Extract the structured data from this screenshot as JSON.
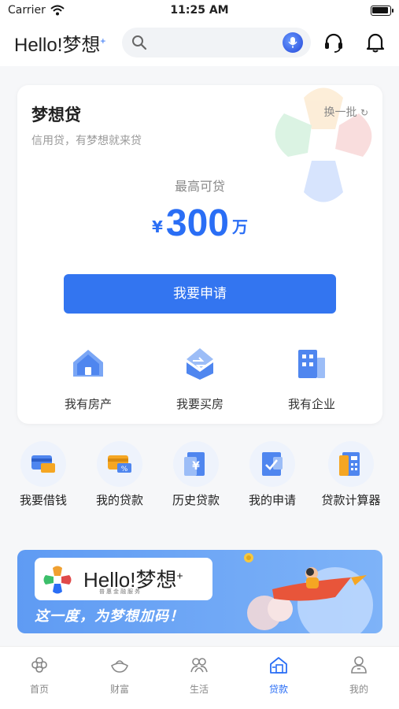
{
  "status_bar": {
    "carrier": "Carrier",
    "time": "11:25 AM"
  },
  "header": {
    "logo_text": "Hello!梦想",
    "logo_mark": "+",
    "search_placeholder": "",
    "icons": [
      "search-icon",
      "microphone-icon",
      "headset-icon",
      "bell-icon"
    ]
  },
  "loan_card": {
    "title": "梦想贷",
    "subtitle": "信用贷，有梦想就来贷",
    "refresh_label": "换一批",
    "max_label": "最高可贷",
    "currency_symbol": "¥",
    "amount": "300",
    "amount_unit": "万",
    "apply_button": "我要申请",
    "features": [
      {
        "label": "我有房产",
        "icon": "house-icon"
      },
      {
        "label": "我要买房",
        "icon": "buy-house-icon"
      },
      {
        "label": "我有企业",
        "icon": "building-icon"
      }
    ]
  },
  "quick_actions": [
    {
      "label": "我要借钱",
      "icon": "card-borrow-icon"
    },
    {
      "label": "我的贷款",
      "icon": "card-percent-icon"
    },
    {
      "label": "历史贷款",
      "icon": "history-yen-icon"
    },
    {
      "label": "我的申请",
      "icon": "application-check-icon"
    },
    {
      "label": "贷款计算器",
      "icon": "calculator-icon"
    }
  ],
  "banner": {
    "brand": "Hello!梦想",
    "brand_mark": "+",
    "tagline": "普惠金融服务",
    "slogan": "这一度，为梦想加码！"
  },
  "tab_bar": {
    "active_index": 3,
    "items": [
      {
        "label": "首页",
        "icon": "home-icon"
      },
      {
        "label": "财富",
        "icon": "wealth-icon"
      },
      {
        "label": "生活",
        "icon": "life-icon"
      },
      {
        "label": "贷款",
        "icon": "loan-icon"
      },
      {
        "label": "我的",
        "icon": "profile-icon"
      }
    ]
  },
  "colors": {
    "accent": "#3375f0",
    "page_bg": "#f6f7f9",
    "banner": "#6aa6f6"
  }
}
